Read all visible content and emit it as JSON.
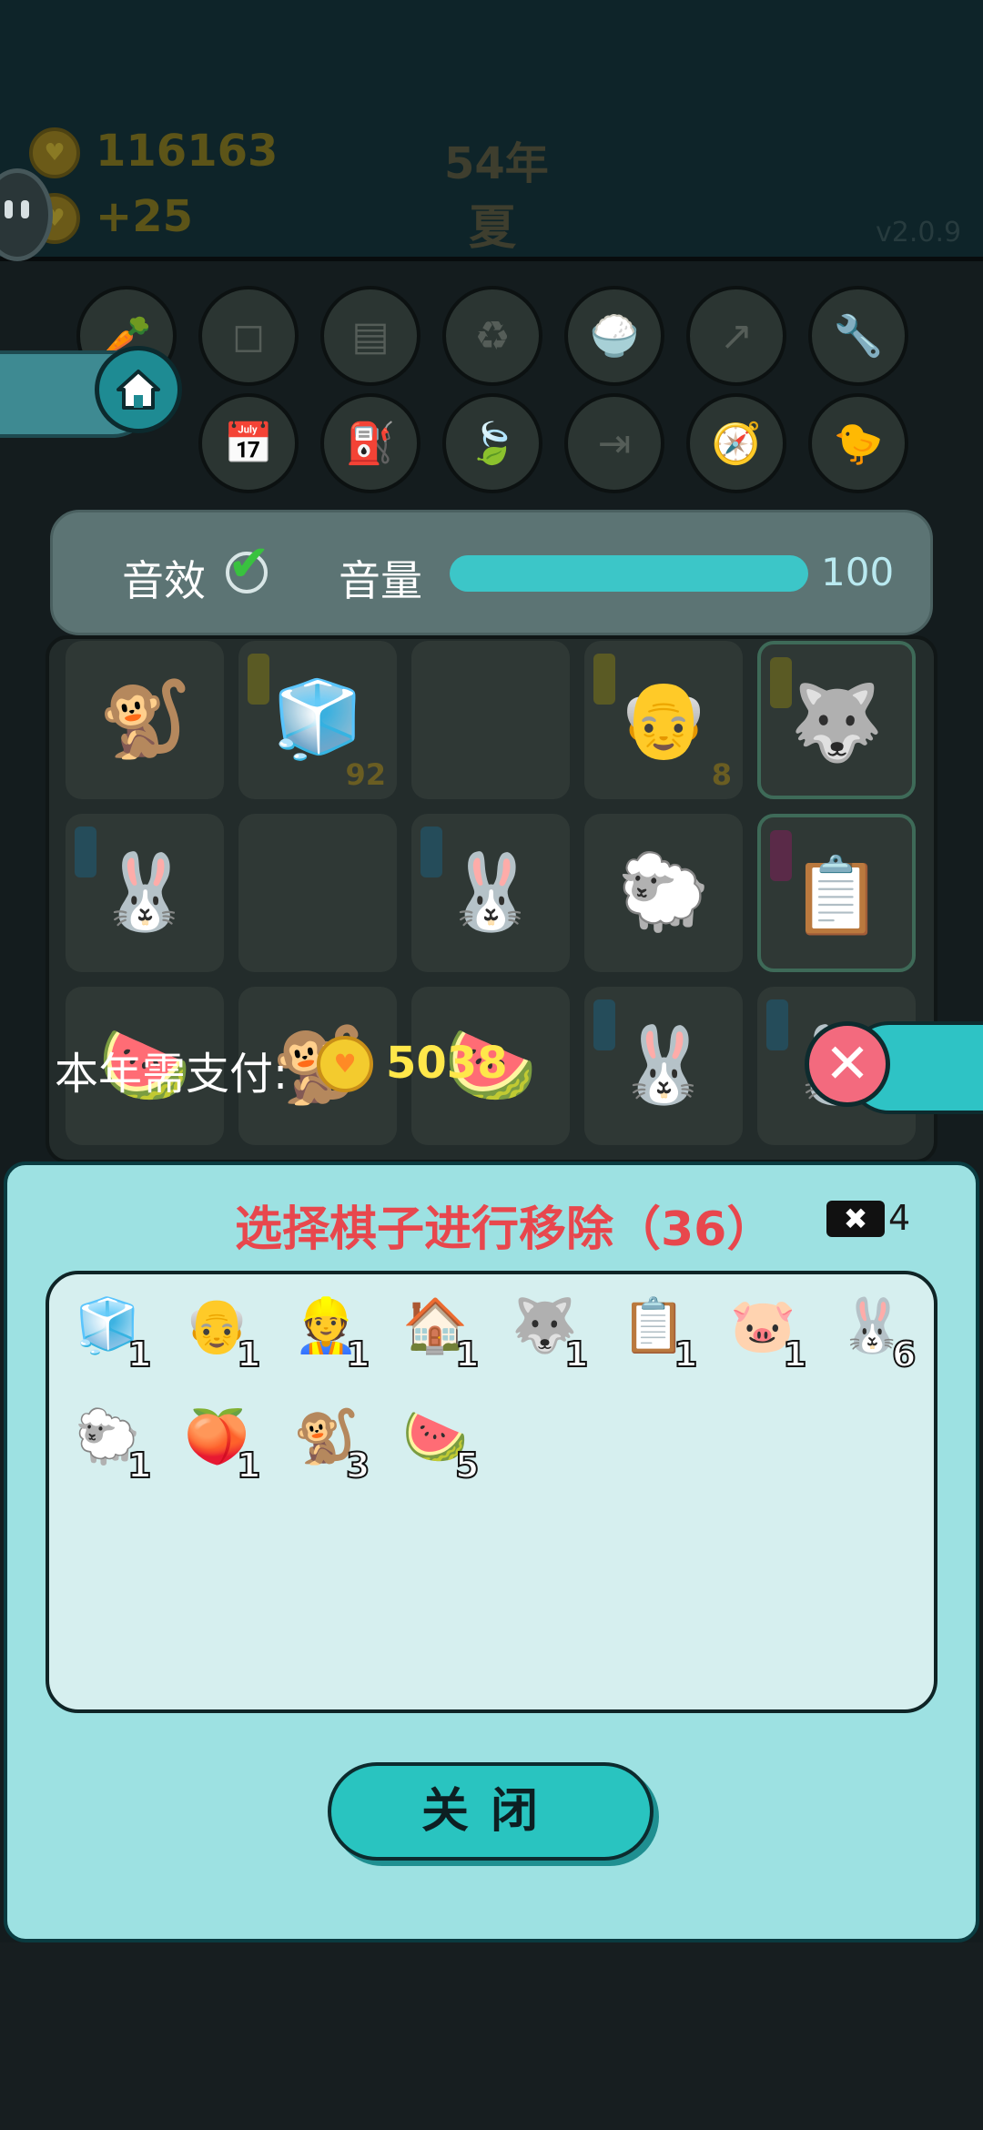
{
  "header": {
    "gold_count": "116163",
    "gold_rate": "+25",
    "year": "54年",
    "season": "夏",
    "version": "v2.0.9"
  },
  "settings": {
    "sound_effects_label": "音效",
    "sound_effects_enabled": true,
    "volume_label": "音量",
    "volume_value": "100",
    "volume_fraction": 1.0
  },
  "board": {
    "cells": [
      {
        "piece": "monkey",
        "glyph": "🐒",
        "tag": "",
        "count": ""
      },
      {
        "piece": "fridge",
        "glyph": "🧊",
        "tag": "yellow",
        "count": "92"
      },
      {
        "piece": "empty",
        "glyph": "",
        "tag": "",
        "count": ""
      },
      {
        "piece": "grandpa",
        "glyph": "👴",
        "tag": "yellow",
        "count": "8"
      },
      {
        "piece": "husky-king",
        "glyph": "🐺",
        "tag": "yellow",
        "count": ""
      },
      {
        "piece": "rabbit",
        "glyph": "🐰",
        "tag": "blue",
        "count": ""
      },
      {
        "piece": "empty",
        "glyph": "",
        "tag": "",
        "count": ""
      },
      {
        "piece": "rabbit",
        "glyph": "🐰",
        "tag": "blue",
        "count": ""
      },
      {
        "piece": "sheep",
        "glyph": "🐑",
        "tag": "",
        "count": ""
      },
      {
        "piece": "copy-paste",
        "glyph": "📋",
        "tag": "pink",
        "count": ""
      },
      {
        "piece": "watermelon",
        "glyph": "🍉",
        "tag": "",
        "count": ""
      },
      {
        "piece": "monkey",
        "glyph": "🐒",
        "tag": "",
        "count": ""
      },
      {
        "piece": "watermelon",
        "glyph": "🍉",
        "tag": "",
        "count": ""
      },
      {
        "piece": "rabbit",
        "glyph": "🐰",
        "tag": "blue",
        "count": ""
      },
      {
        "piece": "rabbit",
        "glyph": "🐰",
        "tag": "blue",
        "count": ""
      }
    ]
  },
  "payment": {
    "label": "本年需支付:",
    "amount": "5038"
  },
  "modal": {
    "title": "选择棋子进行移除（36）",
    "remove_ticket_count": "4",
    "close_label": "关闭",
    "pieces": [
      {
        "name": "fridge",
        "glyph": "🧊",
        "count": "1"
      },
      {
        "name": "grandpa",
        "glyph": "👴",
        "count": "1"
      },
      {
        "name": "worker",
        "glyph": "👷",
        "count": "1"
      },
      {
        "name": "rabbit-house",
        "glyph": "🏠",
        "count": "1"
      },
      {
        "name": "husky-king",
        "glyph": "🐺",
        "count": "1"
      },
      {
        "name": "copy-paste",
        "glyph": "📋",
        "count": "1"
      },
      {
        "name": "pig",
        "glyph": "🐷",
        "count": "1"
      },
      {
        "name": "rabbit",
        "glyph": "🐰",
        "count": "6"
      },
      {
        "name": "sheep",
        "glyph": "🐑",
        "count": "1"
      },
      {
        "name": "peach",
        "glyph": "🍑",
        "count": "1"
      },
      {
        "name": "monkey",
        "glyph": "🐒",
        "count": "3"
      },
      {
        "name": "watermelon",
        "glyph": "🍉",
        "count": "5"
      }
    ]
  },
  "colors": {
    "accent": "#29c4c0",
    "title_red": "#e8474d",
    "gold": "#ffe74a",
    "modal_bg": "#9de1e2"
  }
}
